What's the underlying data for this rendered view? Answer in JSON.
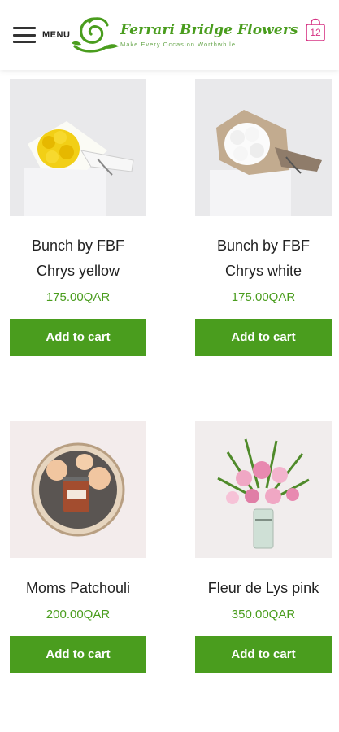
{
  "header": {
    "menu_label": "MENU",
    "logo_title": "Ferrari Bridge Flowers",
    "logo_tagline": "Make Every Occasion Worthwhile",
    "cart_count": "12",
    "brand_color": "#4a9d1e",
    "cart_color": "#d63384"
  },
  "products": [
    {
      "name_line1": "Bunch by FBF",
      "name_line2": "Chrys yellow",
      "price": "175.00QAR",
      "button": "Add to cart",
      "image": "yellow-chrysanthemum-bouquet"
    },
    {
      "name_line1": "Bunch by FBF",
      "name_line2": "Chrys white",
      "price": "175.00QAR",
      "button": "Add to cart",
      "image": "white-chrysanthemum-bouquet"
    },
    {
      "name_line1": "Moms Patchouli",
      "price": "200.00QAR",
      "button": "Add to cart",
      "image": "roses-candle-box"
    },
    {
      "name_line1": "Fleur de Lys pink",
      "price": "350.00QAR",
      "button": "Add to cart",
      "image": "pink-lily-vase"
    }
  ]
}
